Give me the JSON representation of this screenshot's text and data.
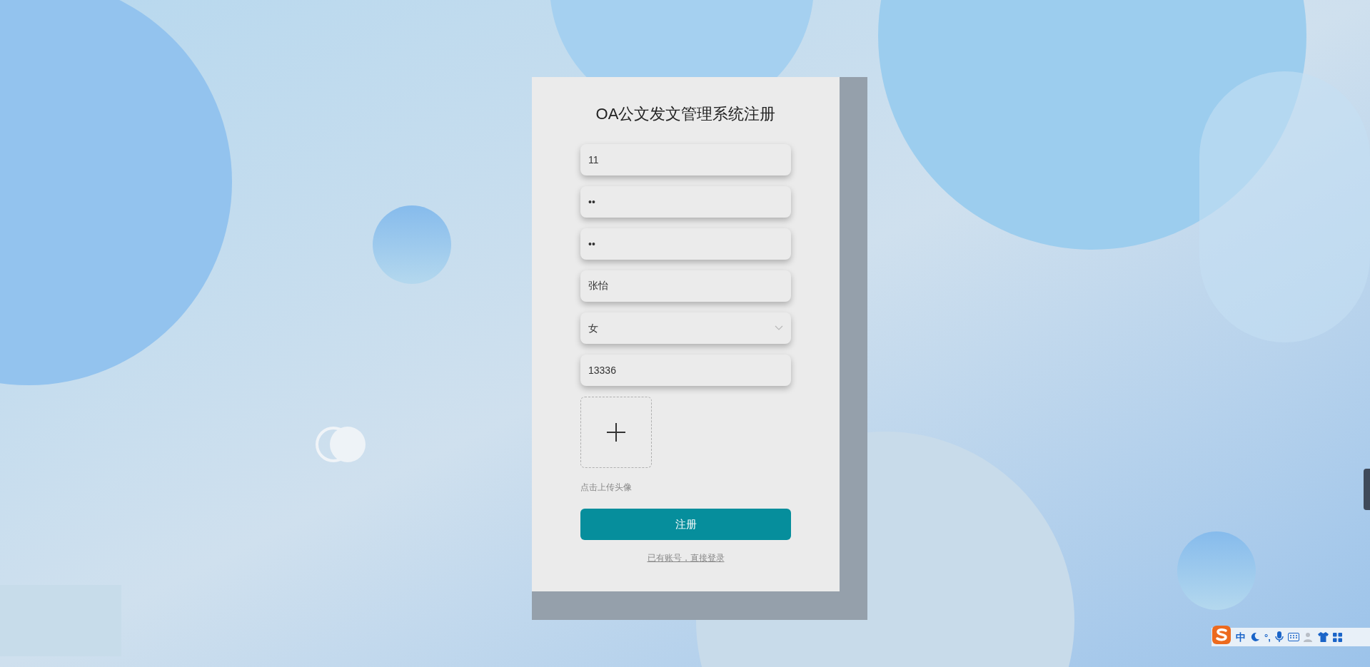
{
  "form": {
    "title": "OA公文发文管理系统注册",
    "fields": [
      {
        "kind": "text",
        "value": "11"
      },
      {
        "kind": "text",
        "value": "••"
      },
      {
        "kind": "text",
        "value": "••"
      },
      {
        "kind": "text",
        "value": "张怡"
      },
      {
        "kind": "select",
        "value": "女"
      },
      {
        "kind": "text",
        "value": "13336"
      }
    ],
    "upload_hint": "点击上传头像",
    "submit": "注册",
    "login_link": "已有账号，直接登录"
  },
  "ime_toolbar": {
    "mode": "中",
    "punctuation": "°,"
  }
}
